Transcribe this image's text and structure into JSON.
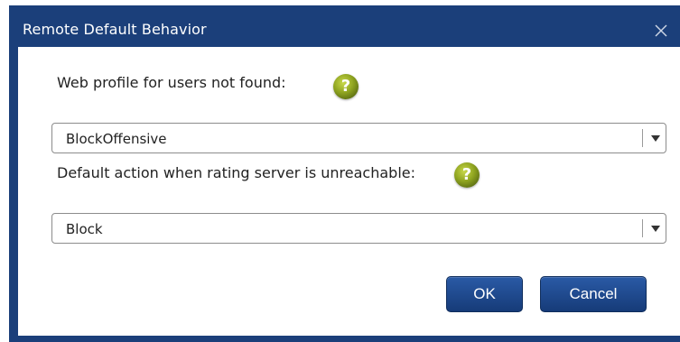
{
  "dialog": {
    "title": "Remote Default Behavior",
    "close_icon": "close-icon",
    "colors": {
      "titlebar": "#1b3f7a",
      "button": "#1f4a8f",
      "help_icon": "#8ea320"
    }
  },
  "fields": [
    {
      "label": "Web profile for users not found:",
      "help_icon": "help-icon",
      "help_text": "?",
      "selected_value": "BlockOffensive"
    },
    {
      "label": "Default action when rating server is unreachable:",
      "help_icon": "help-icon",
      "help_text": "?",
      "selected_value": "Block"
    }
  ],
  "buttons": {
    "ok_label": "OK",
    "cancel_label": "Cancel"
  }
}
